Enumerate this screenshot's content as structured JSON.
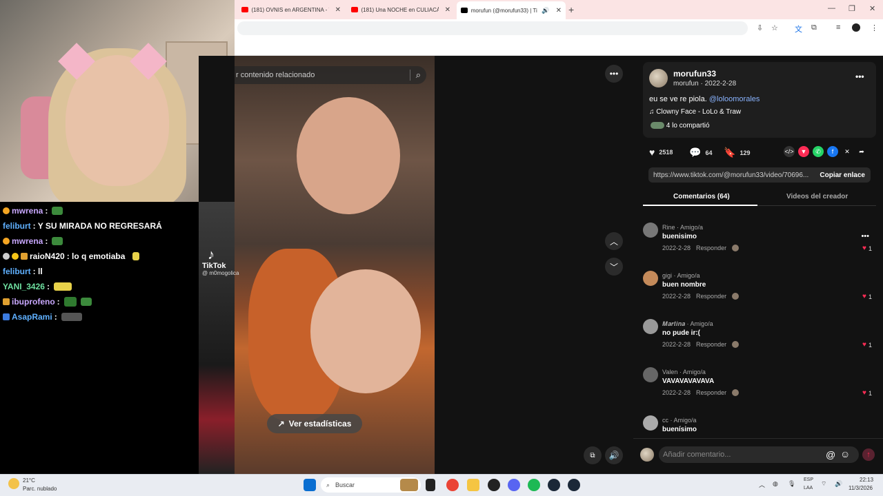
{
  "browser": {
    "tabs": [
      {
        "title": "(181) OVNIS en ARGENTINA - Y",
        "favicon_color": "#ff0000"
      },
      {
        "title": "(181) Una NOCHE en CULIACÁN",
        "favicon_color": "#ff0000"
      },
      {
        "title": "morufun (@morufun33) | Ti",
        "favicon_color": "#000000"
      }
    ],
    "new_tab_icon": "plus-icon",
    "window_controls": [
      "minimize-icon",
      "restore-icon",
      "close-icon"
    ]
  },
  "chat": {
    "messages": [
      {
        "user": "mwrena",
        "text": " : ",
        "user_color": "#c9a8ff",
        "badge": "#f5a623",
        "emote": "#3c8a3c"
      },
      {
        "user": "feliburt",
        "text": " : Y SU MIRADA NO REGRESARÁ",
        "user_color": "#5fb0ff",
        "badge": "",
        "emote": ""
      },
      {
        "user": "mwrena",
        "text": " : ",
        "user_color": "#c9a8ff",
        "badge": "#f5a623",
        "emote": "#3c8a3c"
      },
      {
        "user": "raioN420",
        "text": " : lo q emotiaba",
        "user_color": "#ffffff",
        "badge": "#f5c518",
        "emote": "#e8d24a"
      },
      {
        "user": "feliburt",
        "text": " : ll",
        "user_color": "#5fb0ff",
        "badge": "",
        "emote": ""
      },
      {
        "user": "YANI_3426",
        "text": " : ",
        "user_color": "#6ee0a0",
        "badge": "",
        "emote": "#e8d24a"
      },
      {
        "user": "ibuprofeno",
        "text": " : ",
        "user_color": "#c9a8ff",
        "badge": "#e0a030",
        "emote": "#2f7a2f"
      },
      {
        "user": "AsapRami",
        "text": " : ",
        "user_color": "#5fb0ff",
        "badge": "#3b7be0",
        "emote": "#555555"
      }
    ]
  },
  "video": {
    "search_placeholder": "r contenido relacionado",
    "watermark_name": "TikTok",
    "watermark_user": "@ m0mogolica",
    "stats_label": "Ver estadísticas"
  },
  "post": {
    "author": "morufun33",
    "handle_date": "morufun · 2022-2-28",
    "caption": "eu se ve re piola.",
    "mention": "@loloomorales",
    "music": "Clowny Face - LoLo & Traw",
    "shared": "4 lo compartió",
    "likes": "2518",
    "comments": "64",
    "saves": "129",
    "link": "https://www.tiktok.com/@morufun33/video/70696...",
    "copy_label": "Copiar enlace",
    "tab_comments": "Comentarios (64)",
    "tab_creator": "Videos del creador"
  },
  "comments": [
    {
      "author": "Rine · Amigo/a",
      "text": "buenisimo",
      "date": "2022-2-28",
      "reply": "Responder",
      "likes": "1",
      "avatar": "#777"
    },
    {
      "author": "gigi · Amigo/a",
      "text": "buen nombre",
      "date": "2022-2-28",
      "reply": "Responder",
      "likes": "1",
      "avatar": "#c48a5a"
    },
    {
      "author": "𝑴𝒂𝒓𝒕𝒊𝒏𝒂 · Amigo/a",
      "text": "no pude ir:(",
      "date": "2022-2-28",
      "reply": "Responder",
      "likes": "1",
      "avatar": "#999"
    },
    {
      "author": "Valen · Amigo/a",
      "text": "VAVAVAVAVAVA",
      "date": "2022-2-28",
      "reply": "Responder",
      "likes": "1",
      "avatar": "#666"
    },
    {
      "author": "cc · Amigo/a",
      "text": "buenísimo",
      "date": "",
      "reply": "",
      "likes": "",
      "avatar": "#aaa"
    }
  ],
  "comment_input": {
    "placeholder": "Añadir comentario..."
  },
  "taskbar": {
    "weather_temp": "21°C",
    "weather_desc": "Parc. nublado",
    "search_label": "Buscar",
    "lang": "ESP",
    "lang2": "LAA",
    "time": "22:13",
    "date": "11/3/2026"
  }
}
